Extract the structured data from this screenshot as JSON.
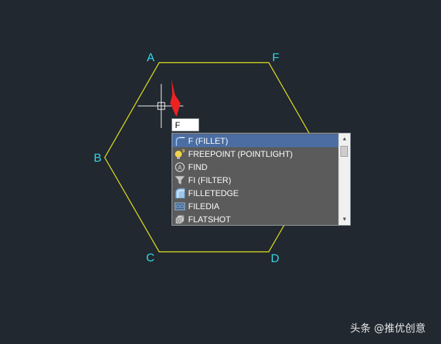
{
  "drawing": {
    "line_color": "#d4d41e",
    "label_color": "#2fd8e8",
    "vertices": {
      "a": "A",
      "f": "F",
      "b": "B",
      "c": "C",
      "d": "D"
    }
  },
  "command_line": {
    "value": "F"
  },
  "autocomplete": {
    "items": [
      {
        "label": "F (FILLET)",
        "icon": "fillet-icon",
        "selected": true
      },
      {
        "label": "FREEPOINT (POINTLIGHT)",
        "icon": "pointlight-icon",
        "selected": false
      },
      {
        "label": "FIND",
        "icon": "find-icon",
        "selected": false
      },
      {
        "label": "FI (FILTER)",
        "icon": "filter-icon",
        "selected": false
      },
      {
        "label": "FILLETEDGE",
        "icon": "filletedge-icon",
        "selected": false
      },
      {
        "label": "FILEDIA",
        "icon": "filedia-icon",
        "selected": false
      },
      {
        "label": "FLATSHOT",
        "icon": "flatshot-icon",
        "selected": false
      }
    ],
    "selection_color": "#4b6da2"
  },
  "annotation": {
    "arrow_color": "#ee2222"
  },
  "watermark": {
    "text": "头条 @推优创意"
  }
}
